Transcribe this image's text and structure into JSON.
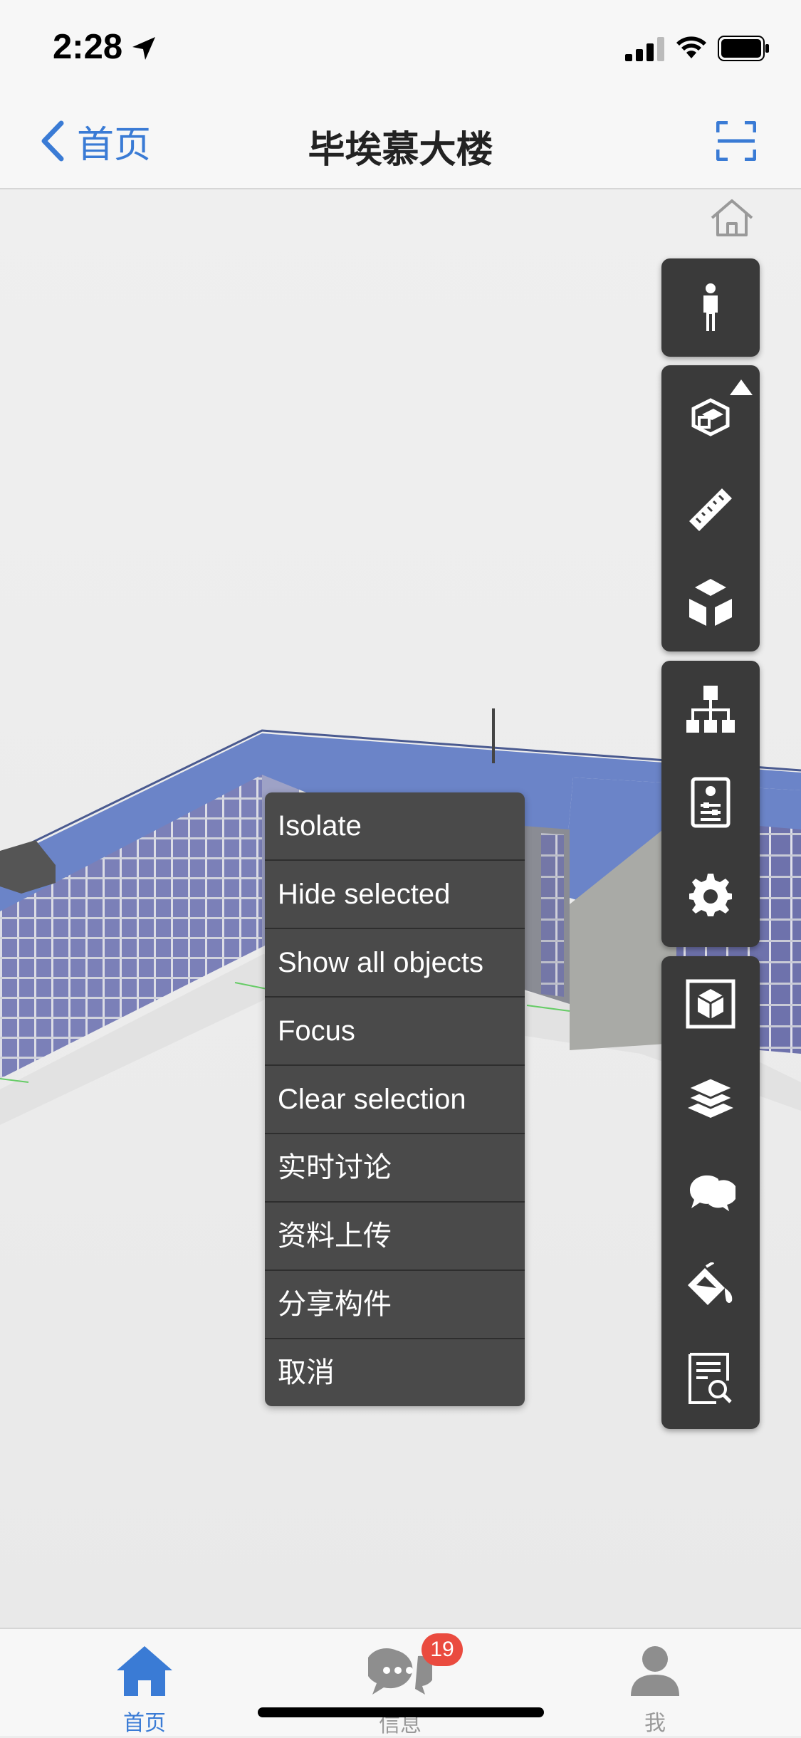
{
  "status_bar": {
    "time": "2:28"
  },
  "nav": {
    "back_label": "首页",
    "title": "毕埃慕大楼"
  },
  "toolbar": {
    "groups": [
      [
        "person-icon"
      ],
      [
        "section-box-icon",
        "ruler-icon",
        "cube-explode-icon"
      ],
      [
        "hierarchy-icon",
        "properties-icon",
        "gear-icon"
      ],
      [
        "cube-view-icon",
        "layers-icon",
        "chat-icon",
        "paint-bucket-icon",
        "document-search-icon"
      ]
    ]
  },
  "context_menu": {
    "items": [
      "Isolate",
      "Hide selected",
      "Show all objects",
      "Focus",
      "Clear selection",
      "实时讨论",
      "资料上传",
      "分享构件",
      "取消"
    ]
  },
  "tab_bar": {
    "tabs": [
      {
        "label": "首页",
        "active": true
      },
      {
        "label": "信息",
        "active": false
      },
      {
        "label": "我",
        "active": false
      }
    ],
    "badge_count": "19"
  },
  "colors": {
    "accent": "#3a7bd5",
    "toolbar_bg": "#3a3a3a",
    "menu_bg": "#4a4a4a",
    "badge": "#ea4b3f",
    "roof": "#6b84c8"
  }
}
